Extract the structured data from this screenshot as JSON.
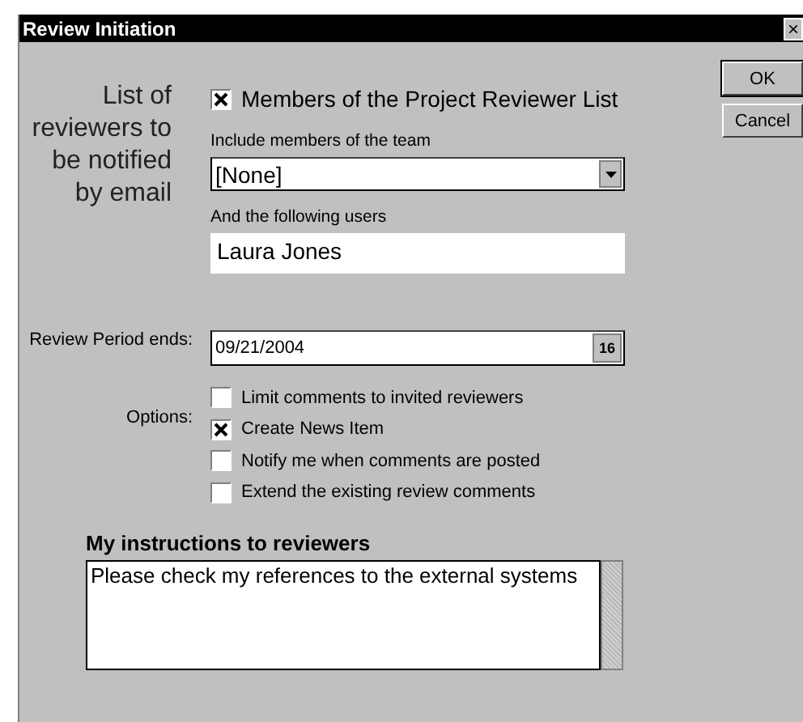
{
  "window": {
    "title": "Review Initiation",
    "close": "×"
  },
  "recipients": {
    "label": "List of reviewers to be notified by email",
    "members_list": {
      "label": "Members of the Project Reviewer List",
      "checked": true
    },
    "team_label": "Include members of the team",
    "team_value": "[None]",
    "users_label": "And the following users",
    "users_value": "Laura Jones"
  },
  "review_period": {
    "label": "Review Period ends:",
    "value": "09/21/2004",
    "calendar_button": "16"
  },
  "options": {
    "label": "Options:",
    "items": [
      {
        "label": "Limit comments to invited reviewers",
        "checked": false
      },
      {
        "label": "Create News Item",
        "checked": true
      },
      {
        "label": "Notify me when comments are posted",
        "checked": false
      },
      {
        "label": "Extend the existing review comments",
        "checked": false
      }
    ]
  },
  "instructions": {
    "label": "My instructions to reviewers",
    "value": "Please check my references to the external systems"
  },
  "buttons": [
    "OK",
    "Cancel"
  ]
}
